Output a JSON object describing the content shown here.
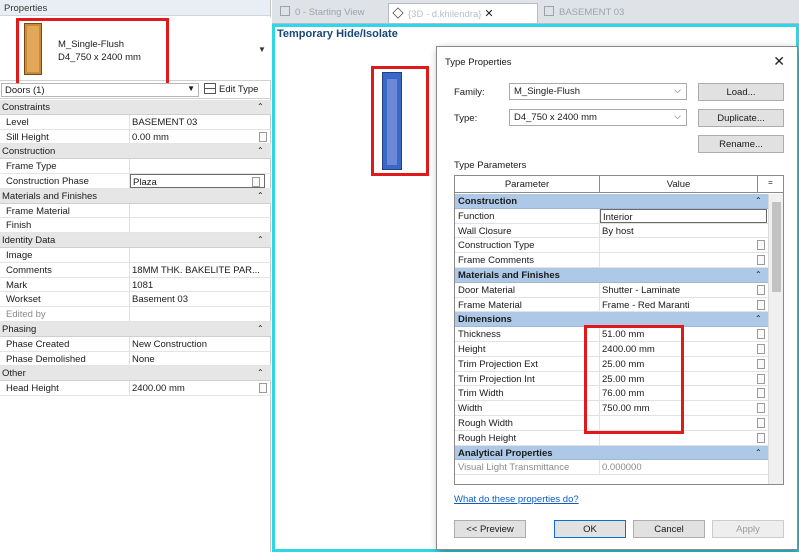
{
  "props": {
    "title": "Properties",
    "type_family": "M_Single-Flush",
    "type_name": "D4_750 x 2400 mm",
    "filter": "Doors (1)",
    "edit_type": "Edit Type",
    "rows": [
      {
        "kind": "group",
        "label": "Constraints"
      },
      {
        "kind": "row",
        "name": "Level",
        "value": "BASEMENT 03"
      },
      {
        "kind": "row",
        "name": "Sill Height",
        "value": "0.00 mm",
        "edit": true
      },
      {
        "kind": "group",
        "label": "Construction"
      },
      {
        "kind": "row",
        "name": "Frame Type",
        "value": ""
      },
      {
        "kind": "row",
        "name": "Construction Phase",
        "value": "Plaza",
        "boxed": true,
        "edit": true
      },
      {
        "kind": "group",
        "label": "Materials and Finishes"
      },
      {
        "kind": "row",
        "name": "Frame Material",
        "value": ""
      },
      {
        "kind": "row",
        "name": "Finish",
        "value": ""
      },
      {
        "kind": "group",
        "label": "Identity Data"
      },
      {
        "kind": "row",
        "name": "Image",
        "value": ""
      },
      {
        "kind": "row",
        "name": "Comments",
        "value": "18MM THK. BAKELITE PAR..."
      },
      {
        "kind": "row",
        "name": "Mark",
        "value": "1081"
      },
      {
        "kind": "row",
        "name": "Workset",
        "value": "Basement 03"
      },
      {
        "kind": "row",
        "name": "Edited by",
        "value": "",
        "disabled": true
      },
      {
        "kind": "group",
        "label": "Phasing"
      },
      {
        "kind": "row",
        "name": "Phase Created",
        "value": "New Construction"
      },
      {
        "kind": "row",
        "name": "Phase Demolished",
        "value": "None"
      },
      {
        "kind": "group",
        "label": "Other"
      },
      {
        "kind": "row",
        "name": "Head Height",
        "value": "2400.00 mm",
        "edit": true
      }
    ]
  },
  "tabs": {
    "t1": "0 - Starting View",
    "t2": "{3D - d.khilendra}",
    "t3": "BASEMENT 03"
  },
  "view": {
    "label": "Temporary Hide/Isolate"
  },
  "dialog": {
    "title": "Type Properties",
    "family_label": "Family:",
    "family_value": "M_Single-Flush",
    "type_label": "Type:",
    "type_value": "D4_750 x 2400 mm",
    "load": "Load...",
    "duplicate": "Duplicate...",
    "rename": "Rename...",
    "type_parameters": "Type Parameters",
    "col_parameter": "Parameter",
    "col_value": "Value",
    "col_eq": "=",
    "rows": [
      {
        "kind": "group",
        "label": "Construction"
      },
      {
        "kind": "row",
        "name": "Function",
        "value": "Interior",
        "boxed": true
      },
      {
        "kind": "row",
        "name": "Wall Closure",
        "value": "By host"
      },
      {
        "kind": "row",
        "name": "Construction Type",
        "value": "",
        "edit": true
      },
      {
        "kind": "row",
        "name": "Frame Comments",
        "value": "",
        "edit": true
      },
      {
        "kind": "group",
        "label": "Materials and Finishes"
      },
      {
        "kind": "row",
        "name": "Door Material",
        "value": "Shutter - Laminate",
        "edit": true
      },
      {
        "kind": "row",
        "name": "Frame Material",
        "value": "Frame - Red Maranti",
        "edit": true
      },
      {
        "kind": "group",
        "label": "Dimensions"
      },
      {
        "kind": "row",
        "name": "Thickness",
        "value": "51.00 mm",
        "edit": true
      },
      {
        "kind": "row",
        "name": "Height",
        "value": "2400.00 mm",
        "edit": true
      },
      {
        "kind": "row",
        "name": "Trim Projection Ext",
        "value": "25.00 mm",
        "edit": true
      },
      {
        "kind": "row",
        "name": "Trim Projection Int",
        "value": "25.00 mm",
        "edit": true
      },
      {
        "kind": "row",
        "name": "Trim Width",
        "value": "76.00 mm",
        "edit": true
      },
      {
        "kind": "row",
        "name": "Width",
        "value": "750.00 mm",
        "edit": true
      },
      {
        "kind": "row",
        "name": "Rough Width",
        "value": "",
        "edit": true
      },
      {
        "kind": "row",
        "name": "Rough Height",
        "value": "",
        "edit": true
      },
      {
        "kind": "group",
        "label": "Analytical Properties"
      },
      {
        "kind": "row",
        "name": "Visual Light Transmittance",
        "value": "0.000000",
        "disabled": true
      }
    ],
    "link": "What do these properties do?",
    "preview": "<< Preview",
    "ok": "OK",
    "cancel": "Cancel",
    "apply": "Apply"
  },
  "colors": {
    "group_header_dialog": "#aec9e8",
    "highlight_red": "#e01a1a",
    "view_border": "#2fd6e6",
    "door_blue": "#3b67c8",
    "door_wood": "#c98a3a"
  }
}
